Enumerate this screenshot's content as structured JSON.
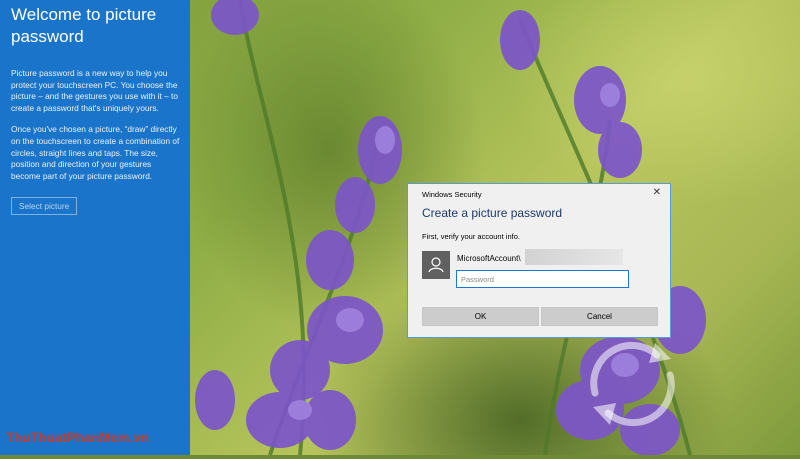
{
  "sidebar": {
    "title": "Welcome to picture password",
    "paragraph1": "Picture password is a new way to help you protect your touchscreen PC. You choose the picture – and the gestures you use with it – to create a password that's uniquely yours.",
    "paragraph2": "Once you've chosen a picture, “draw” directly on the touchscreen to create a combination of circles, straight lines and taps. The size, position and direction of your gestures become part of your picture password.",
    "select_button": "Select picture"
  },
  "dialog": {
    "caption": "Windows Security",
    "title": "Create a picture password",
    "subtitle": "First, verify your account info.",
    "account_label": "MicrosoftAccount\\",
    "password_placeholder": "Password",
    "ok_label": "OK",
    "cancel_label": "Cancel",
    "close_icon": "close-icon"
  },
  "watermark": "ThuThuatPhanMem.vn",
  "colors": {
    "sidebar": "#1a74c9",
    "input_border": "#1a78d4",
    "dialog_title": "#1c3a67"
  }
}
